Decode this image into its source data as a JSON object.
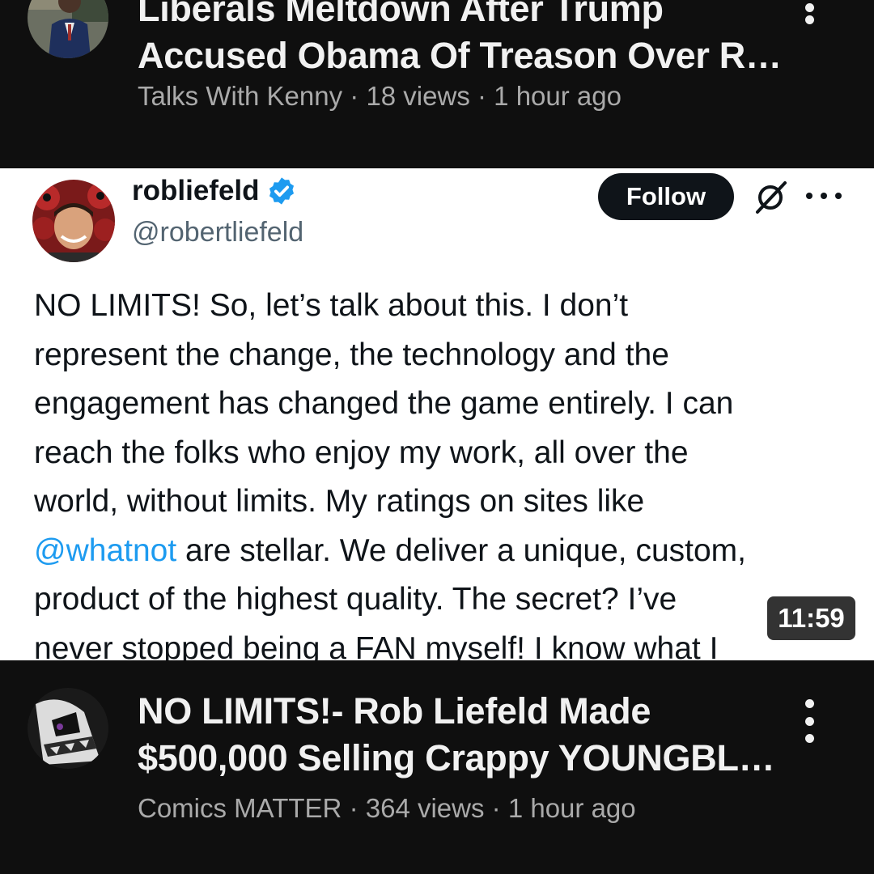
{
  "video_top": {
    "title_lines": [
      "Liberals Meltdown After Trump",
      "Accused Obama Of Treason Over Ru..."
    ],
    "channel": "Talks With Kenny",
    "views": "18 views",
    "age": "1 hour ago",
    "separator": "·"
  },
  "thumbnail": {
    "display_name": "robliefeld",
    "handle": "@robertliefeld",
    "verified_icon": "verified-badge-icon",
    "follow_label": "Follow",
    "tweet_lines": [
      "NO LIMITS! So, let’s talk about this. I don’t",
      "represent the change, the technology and the",
      "engagement has changed the game entirely. I can",
      "reach the folks who enjoy my work, all over the",
      "world, without limits. My ratings on sites like",
      "",
      "product of the highest quality. The secret? I’ve",
      "never stopped being a FAN myself! I know what I"
    ],
    "mention": "@whatnot",
    "mention_line_rest": " are stellar. We deliver a unique, custom,",
    "duration": "11:59",
    "link_color": "#1d9bf0",
    "verified_color": "#1d9bf0"
  },
  "video_bottom": {
    "title_lines": [
      "NO LIMITS!- Rob Liefeld Made",
      "$500,000 Selling Crappy YOUNGBLO..."
    ],
    "channel": "Comics MATTER",
    "views": "364 views",
    "age": "1 hour ago",
    "separator": "·"
  }
}
